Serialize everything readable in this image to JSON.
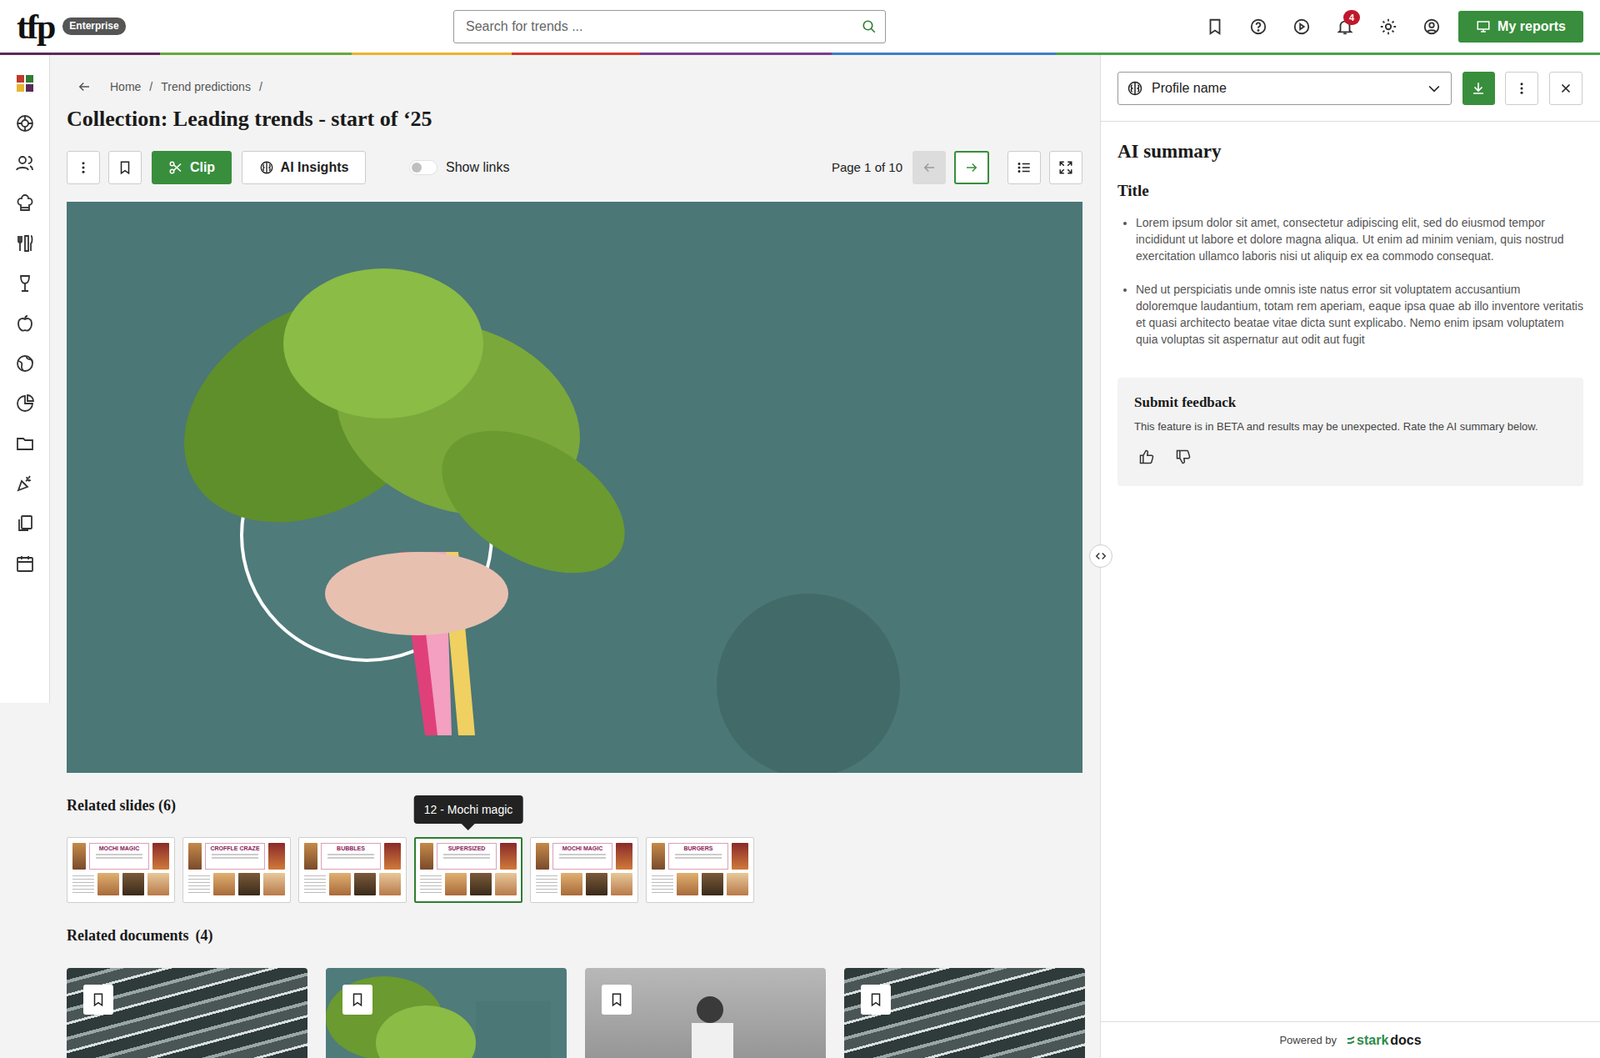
{
  "header": {
    "logo": "tfp",
    "edition": "Enterprise",
    "search": {
      "placeholder": "Search for trends ..."
    },
    "notifications": "4",
    "reports_button": "My reports"
  },
  "breadcrumb": {
    "separator": "/",
    "items": [
      {
        "label": "Home"
      },
      {
        "label": "Trend predictions"
      }
    ]
  },
  "collection": {
    "title": "Collection: Leading trends - start of ‘25"
  },
  "toolbar": {
    "clip": "Clip",
    "ai_insights": "AI Insights",
    "show_links": {
      "label": "Show links",
      "on": false
    },
    "page": "Page 1 of 10",
    "prev": {
      "disabled": true
    },
    "next": {
      "disabled": false
    }
  },
  "related_slides": {
    "heading": "Related slides (6)",
    "tooltip": "12 - Mochi magic",
    "items": [
      {
        "title": "MOCHI MAGIC",
        "selected": false
      },
      {
        "title": "CROFFLE CRAZE",
        "selected": false
      },
      {
        "title": "BUBBLES",
        "selected": false
      },
      {
        "title": "SUPERSIZED",
        "selected": true
      },
      {
        "title": "MOCHI MAGIC",
        "selected": false
      },
      {
        "title": "BURGERS",
        "selected": false
      }
    ]
  },
  "related_documents": {
    "heading": "Related documents",
    "count": "(4)",
    "items": [
      {
        "kind": "pattern",
        "bookmarked": false
      },
      {
        "kind": "cover",
        "bookmarked": false
      },
      {
        "kind": "photo",
        "bookmarked": false
      },
      {
        "kind": "pattern",
        "bookmarked": false
      }
    ]
  },
  "panel": {
    "profile": "Profile name",
    "heading": "AI summary",
    "section_title": "Title",
    "bullets": [
      "Lorem ipsum dolor sit amet, consectetur adipiscing elit, sed do eiusmod tempor incididunt ut labore et dolore magna aliqua. Ut enim ad minim veniam, quis nostrud exercitation ullamco laboris nisi ut aliquip ex ea commodo consequat.",
      "Ned ut perspiciatis unde omnis iste natus error sit voluptatem accusantium doloremque laudantium, totam rem aperiam, eaque ipsa quae ab illo inventore veritatis et quasi architecto beatae vitae dicta sunt explicabo. Nemo enim ipsam voluptatem quia voluptas sit aspernatur aut odit aut fugit"
    ],
    "feedback": {
      "title": "Submit feedback",
      "text": "This feature is in BETA and results may be unexpected. Rate the AI summary below."
    },
    "footer": {
      "powered_by": "Powered by",
      "brand_a": "stark",
      "brand_b": "docs"
    }
  }
}
